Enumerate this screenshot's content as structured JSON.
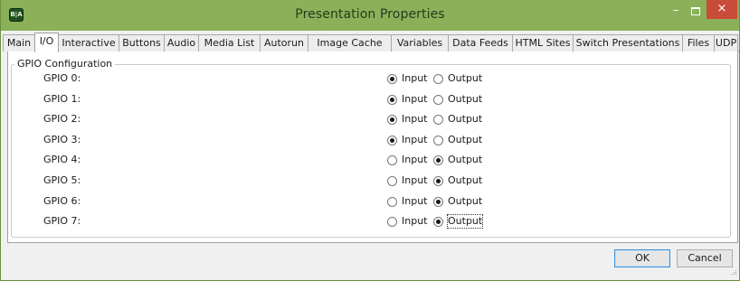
{
  "window": {
    "title": "Presentation Properties",
    "app_icon_text": "B|A",
    "min_glyph": "–",
    "close_glyph": "×"
  },
  "tabs": [
    {
      "label": "Main",
      "active": false
    },
    {
      "label": "I/O",
      "active": true
    },
    {
      "label": "Interactive",
      "active": false
    },
    {
      "label": "Buttons",
      "active": false
    },
    {
      "label": "Audio",
      "active": false
    },
    {
      "label": "Media List",
      "active": false
    },
    {
      "label": "Autorun",
      "active": false
    },
    {
      "label": "Image Cache",
      "active": false
    },
    {
      "label": "Variables",
      "active": false
    },
    {
      "label": "Data Feeds",
      "active": false
    },
    {
      "label": "HTML Sites",
      "active": false
    },
    {
      "label": "Switch Presentations",
      "active": false
    },
    {
      "label": "Files",
      "active": false
    },
    {
      "label": "UDP",
      "active": false
    }
  ],
  "gpio": {
    "group_label": "GPIO Configuration",
    "input_label": "Input",
    "output_label": "Output",
    "rows": [
      {
        "label": "GPIO 0:",
        "mode": "Input"
      },
      {
        "label": "GPIO 1:",
        "mode": "Input"
      },
      {
        "label": "GPIO 2:",
        "mode": "Input"
      },
      {
        "label": "GPIO 3:",
        "mode": "Input"
      },
      {
        "label": "GPIO 4:",
        "mode": "Output"
      },
      {
        "label": "GPIO 5:",
        "mode": "Output"
      },
      {
        "label": "GPIO 6:",
        "mode": "Output"
      },
      {
        "label": "GPIO 7:",
        "mode": "Output"
      }
    ]
  },
  "buttons": {
    "ok": "OK",
    "cancel": "Cancel"
  },
  "colors": {
    "titlebar": "#8ab15a",
    "close": "#c94c3a"
  }
}
